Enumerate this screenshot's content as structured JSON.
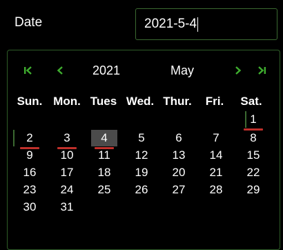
{
  "field": {
    "label": "Date",
    "value": "2021-5-4"
  },
  "calendar": {
    "year": "2021",
    "month": "May",
    "weekdays": [
      "Sun.",
      "Mon.",
      "Tues",
      "Wed.",
      "Thur.",
      "Fri.",
      "Sat."
    ],
    "days": [
      {
        "d": "1",
        "col": 6,
        "row": 0,
        "marked": true
      },
      {
        "d": "2",
        "col": 0,
        "row": 1,
        "marked": true
      },
      {
        "d": "3",
        "col": 1,
        "row": 1,
        "marked": true
      },
      {
        "d": "4",
        "col": 2,
        "row": 1,
        "marked": true,
        "selected": true
      },
      {
        "d": "5",
        "col": 3,
        "row": 1
      },
      {
        "d": "6",
        "col": 4,
        "row": 1
      },
      {
        "d": "7",
        "col": 5,
        "row": 1
      },
      {
        "d": "8",
        "col": 6,
        "row": 1
      },
      {
        "d": "9",
        "col": 0,
        "row": 2
      },
      {
        "d": "10",
        "col": 1,
        "row": 2
      },
      {
        "d": "11",
        "col": 2,
        "row": 2
      },
      {
        "d": "12",
        "col": 3,
        "row": 2
      },
      {
        "d": "13",
        "col": 4,
        "row": 2
      },
      {
        "d": "14",
        "col": 5,
        "row": 2
      },
      {
        "d": "15",
        "col": 6,
        "row": 2
      },
      {
        "d": "16",
        "col": 0,
        "row": 3
      },
      {
        "d": "17",
        "col": 1,
        "row": 3
      },
      {
        "d": "18",
        "col": 2,
        "row": 3
      },
      {
        "d": "19",
        "col": 3,
        "row": 3
      },
      {
        "d": "20",
        "col": 4,
        "row": 3
      },
      {
        "d": "21",
        "col": 5,
        "row": 3
      },
      {
        "d": "22",
        "col": 6,
        "row": 3
      },
      {
        "d": "23",
        "col": 0,
        "row": 4
      },
      {
        "d": "24",
        "col": 1,
        "row": 4
      },
      {
        "d": "25",
        "col": 2,
        "row": 4
      },
      {
        "d": "26",
        "col": 3,
        "row": 4
      },
      {
        "d": "27",
        "col": 4,
        "row": 4
      },
      {
        "d": "28",
        "col": 5,
        "row": 4
      },
      {
        "d": "29",
        "col": 6,
        "row": 4
      },
      {
        "d": "30",
        "col": 0,
        "row": 5
      },
      {
        "d": "31",
        "col": 1,
        "row": 5
      }
    ]
  },
  "colors": {
    "accent": "#3fae2f",
    "border": "#3b6a31",
    "marker": "#c0302b",
    "selected_bg": "#4b4b4b"
  },
  "icons": {
    "first": "double-chevron-left-icon",
    "prev": "chevron-left-icon",
    "next": "chevron-right-icon",
    "last": "double-chevron-right-icon"
  }
}
